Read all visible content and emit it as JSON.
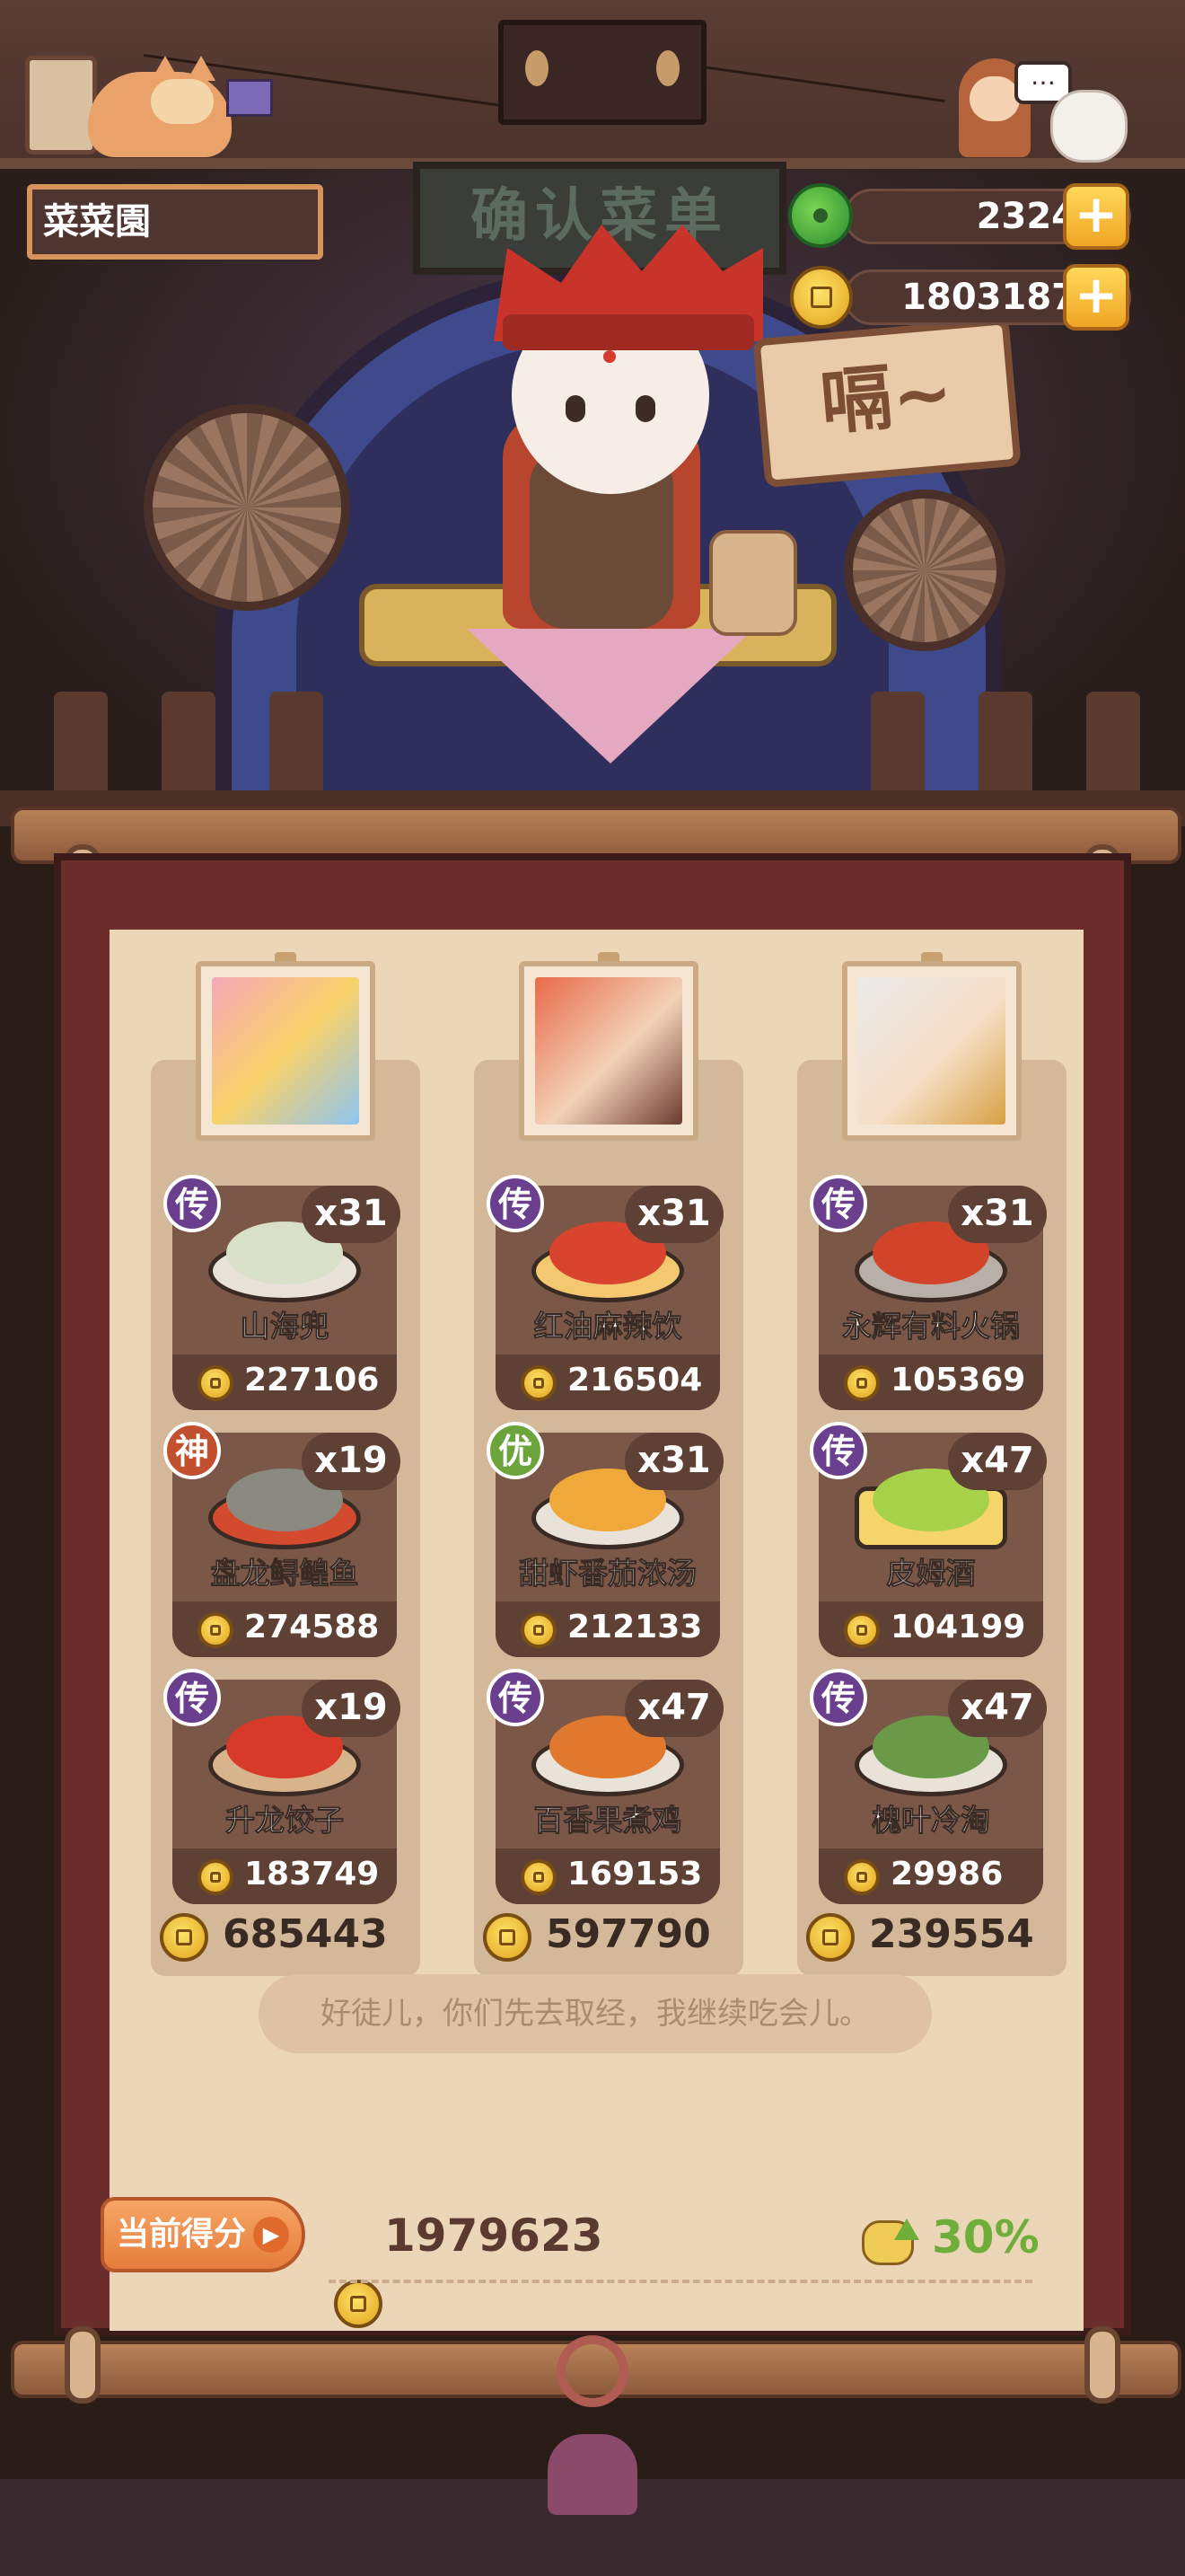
{
  "location": "菜菜園",
  "resources": {
    "jade": "2324",
    "coins": "1803187"
  },
  "scene": {
    "menu_sign": "确认菜单",
    "speech": "嗝~"
  },
  "columns": [
    {
      "total": "685443",
      "dishes": [
        {
          "badge": "传",
          "count": "x31",
          "name": "山海兜",
          "price": "227106"
        },
        {
          "badge": "神",
          "count": "x19",
          "name": "盘龙鲟鳇鱼",
          "price": "274588"
        },
        {
          "badge": "传",
          "count": "x19",
          "name": "升龙饺子",
          "price": "183749"
        }
      ]
    },
    {
      "total": "597790",
      "dishes": [
        {
          "badge": "传",
          "count": "x31",
          "name": "红油麻辣饮",
          "price": "216504"
        },
        {
          "badge": "优",
          "count": "x31",
          "name": "甜虾番茄浓汤",
          "price": "212133"
        },
        {
          "badge": "传",
          "count": "x47",
          "name": "百香果煮鸡",
          "price": "169153"
        }
      ]
    },
    {
      "total": "239554",
      "dishes": [
        {
          "badge": "传",
          "count": "x31",
          "name": "永辉有料火锅",
          "price": "105369"
        },
        {
          "badge": "传",
          "count": "x47",
          "name": "皮姆酒",
          "price": "104199"
        },
        {
          "badge": "传",
          "count": "x47",
          "name": "槐叶冷淘",
          "price": "29986"
        }
      ]
    }
  ],
  "quote": "好徒儿，你们先去取经，我继续吃会儿。",
  "score": {
    "label": "当前得分",
    "value": "1979623",
    "bonus": "30%"
  }
}
